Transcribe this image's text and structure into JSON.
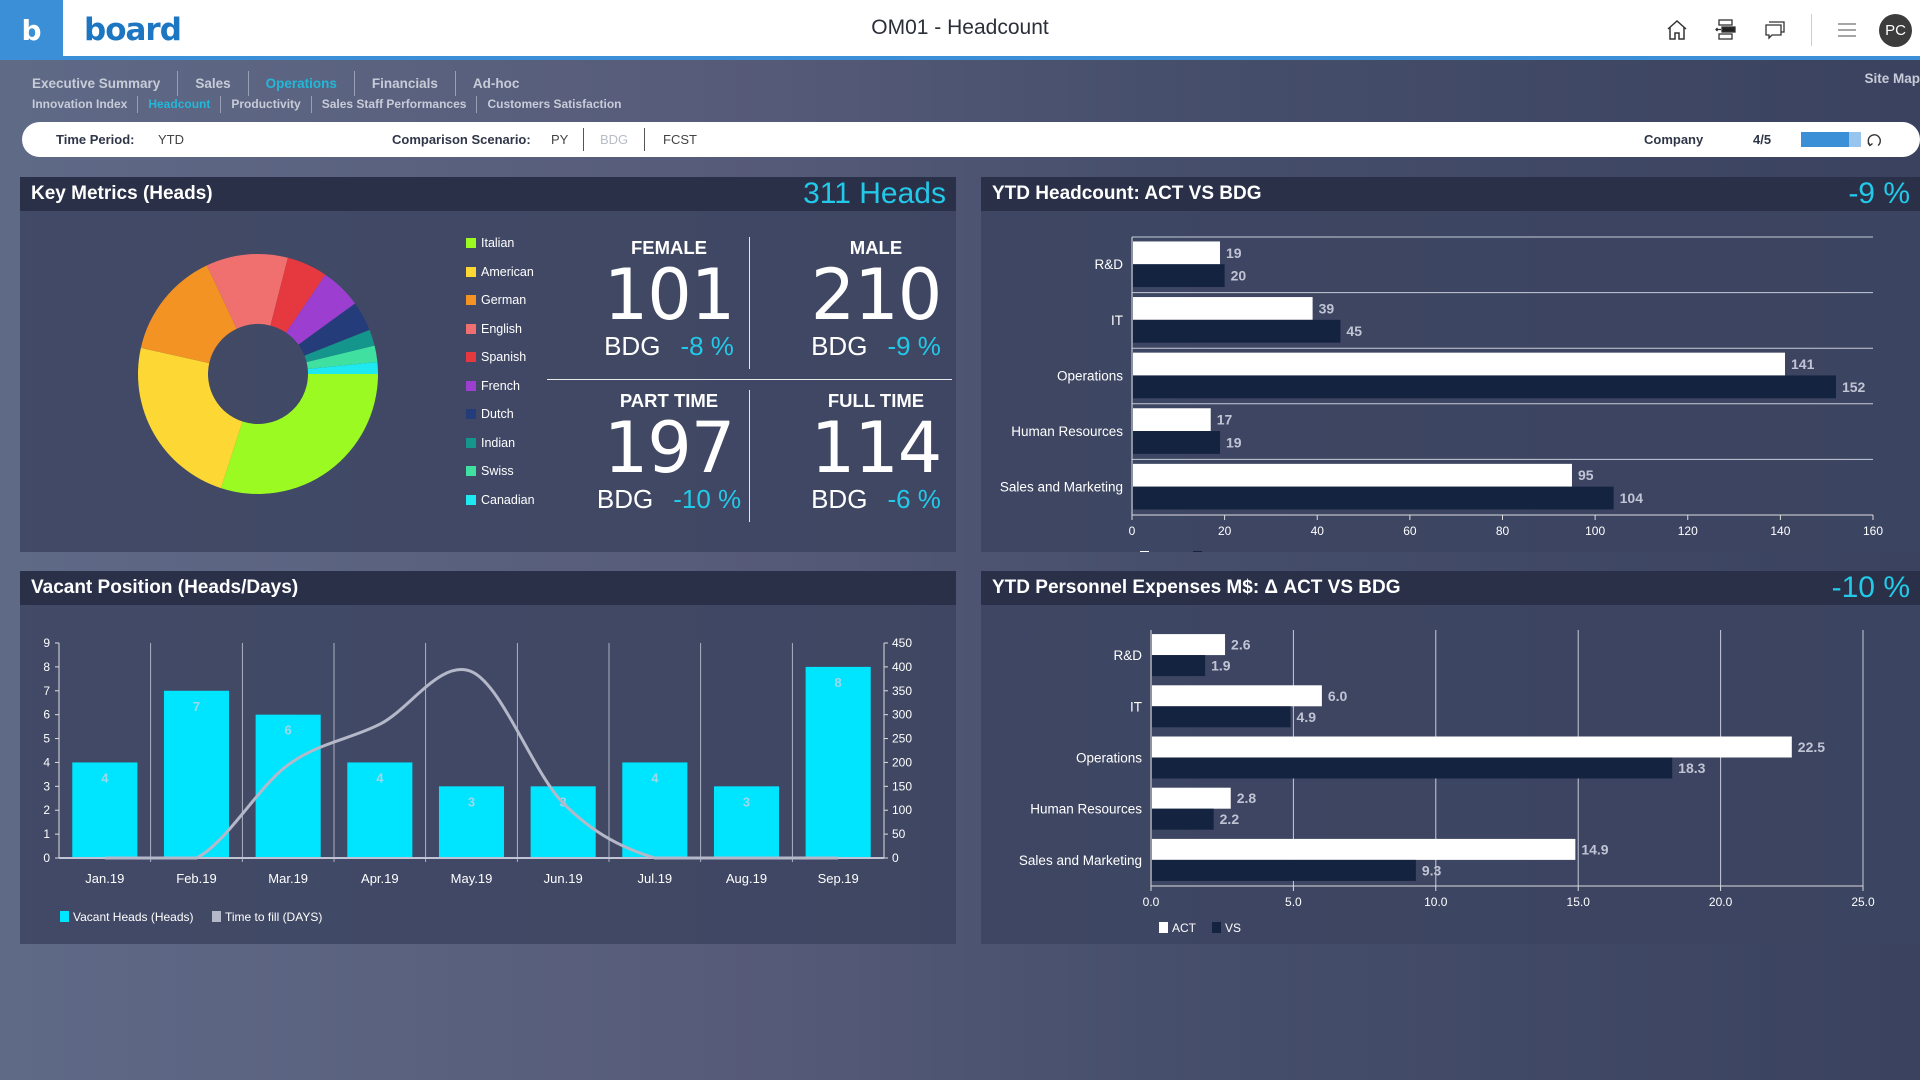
{
  "header": {
    "brand_mark": "b",
    "logo_text": "board",
    "title": "OM01 - Headcount",
    "user_initials": "PC",
    "icons": [
      "home-icon",
      "screen-split-icon",
      "chat-icon",
      "menu-icon"
    ]
  },
  "nav": {
    "primary": [
      {
        "label": "Executive Summary",
        "active": false
      },
      {
        "label": "Sales",
        "active": false
      },
      {
        "label": "Operations",
        "active": true
      },
      {
        "label": "Financials",
        "active": false
      },
      {
        "label": "Ad-hoc",
        "active": false
      }
    ],
    "secondary": [
      {
        "label": "Innovation Index",
        "active": false
      },
      {
        "label": "Headcount",
        "active": true
      },
      {
        "label": "Productivity",
        "active": false
      },
      {
        "label": "Sales Staff Performances",
        "active": false
      },
      {
        "label": "Customers Satisfaction",
        "active": false
      }
    ],
    "site_map": "Site Map"
  },
  "filters": {
    "time_period_label": "Time Period:",
    "time_period_value": "YTD",
    "comparison_label": "Comparison Scenario:",
    "comparison_options": [
      "PY",
      "BDG",
      "FCST"
    ],
    "comparison_selected": "BDG",
    "company_label": "Company",
    "company_value": "4/5",
    "company_progress": 0.8
  },
  "key_metrics": {
    "title": "Key Metrics (Heads)",
    "total": "311 Heads",
    "cards": [
      {
        "title": "FEMALE",
        "value": "101",
        "ref": "BDG",
        "delta": "-8 %"
      },
      {
        "title": "MALE",
        "value": "210",
        "ref": "BDG",
        "delta": "-9 %"
      },
      {
        "title": "PART TIME",
        "value": "197",
        "ref": "BDG",
        "delta": "-10 %"
      },
      {
        "title": "FULL TIME",
        "value": "114",
        "ref": "BDG",
        "delta": "-6 %"
      }
    ]
  },
  "headcount_panel": {
    "title": "YTD Headcount: ACT VS BDG",
    "kpi": "-9 %"
  },
  "expenses_panel": {
    "title": "YTD Personnel Expenses M$: Δ ACT VS BDG",
    "kpi": "-10 %"
  },
  "vacant_panel": {
    "title": "Vacant Position (Heads/Days)"
  },
  "chart_data": [
    {
      "id": "nationality",
      "type": "pie",
      "donut": true,
      "legend_position": "right",
      "labels": [
        "Italian",
        "American",
        "German",
        "English",
        "Spanish",
        "French",
        "Dutch",
        "Indian",
        "Swiss",
        "Canadian"
      ],
      "values": [
        30,
        23.5,
        14.5,
        11,
        5.5,
        5.5,
        4,
        2.2,
        2.2,
        1.6
      ],
      "colors": [
        "#9afa22",
        "#fdd835",
        "#f39324",
        "#f07070",
        "#e5393f",
        "#9c3fd1",
        "#253c7a",
        "#14968c",
        "#40e0a0",
        "#1ee8f0"
      ]
    },
    {
      "id": "headcount",
      "type": "bar",
      "orientation": "horizontal",
      "categories": [
        "R&D",
        "IT",
        "Operations",
        "Human Resources",
        "Sales and Marketing"
      ],
      "series": [
        {
          "name": "ACT",
          "values": [
            19,
            39,
            141,
            17,
            95
          ],
          "color": "#ffffff"
        },
        {
          "name": "VS",
          "values": [
            20,
            45,
            152,
            19,
            104
          ],
          "color": "#142340"
        }
      ],
      "xlim": [
        0,
        160
      ],
      "xticks": [
        "0",
        "20",
        "40",
        "60",
        "80",
        "100",
        "120",
        "140",
        "160"
      ],
      "legend_position": "bottom-left"
    },
    {
      "id": "expenses",
      "type": "bar",
      "orientation": "horizontal",
      "categories": [
        "R&D",
        "IT",
        "Operations",
        "Human Resources",
        "Sales and Marketing"
      ],
      "series": [
        {
          "name": "ACT",
          "values": [
            2.6,
            6.0,
            22.5,
            2.8,
            14.9
          ],
          "color": "#ffffff"
        },
        {
          "name": "VS",
          "values": [
            1.9,
            4.9,
            18.3,
            2.2,
            9.3
          ],
          "color": "#142340"
        }
      ],
      "xlim": [
        0,
        25
      ],
      "xticks": [
        "0.0",
        "5.0",
        "10.0",
        "15.0",
        "20.0",
        "25.0"
      ],
      "legend_position": "bottom-left"
    },
    {
      "id": "vacant",
      "type": "bar",
      "categories": [
        "Jan.19",
        "Feb.19",
        "Mar.19",
        "Apr.19",
        "May.19",
        "Jun.19",
        "Jul.19",
        "Aug.19",
        "Sep.19"
      ],
      "series": [
        {
          "name": "Vacant Heads (Heads)",
          "type": "bar",
          "axis": "left",
          "values": [
            4,
            7,
            6,
            4,
            3,
            3,
            4,
            3,
            8
          ],
          "color": "#00e5ff"
        },
        {
          "name": "Time to fill (DAYS)",
          "type": "line",
          "axis": "right",
          "values": [
            0,
            0,
            195,
            280,
            390,
            115,
            0,
            0,
            0
          ],
          "color": "#b4b8c8"
        }
      ],
      "ylim_left": [
        0,
        9
      ],
      "yticks_left": [
        "0",
        "1",
        "2",
        "3",
        "4",
        "5",
        "6",
        "7",
        "8",
        "9"
      ],
      "ylim_right": [
        0,
        450
      ],
      "yticks_right": [
        "0",
        "50",
        "100",
        "150",
        "200",
        "250",
        "300",
        "350",
        "400",
        "450"
      ],
      "legend_position": "bottom-left"
    }
  ]
}
